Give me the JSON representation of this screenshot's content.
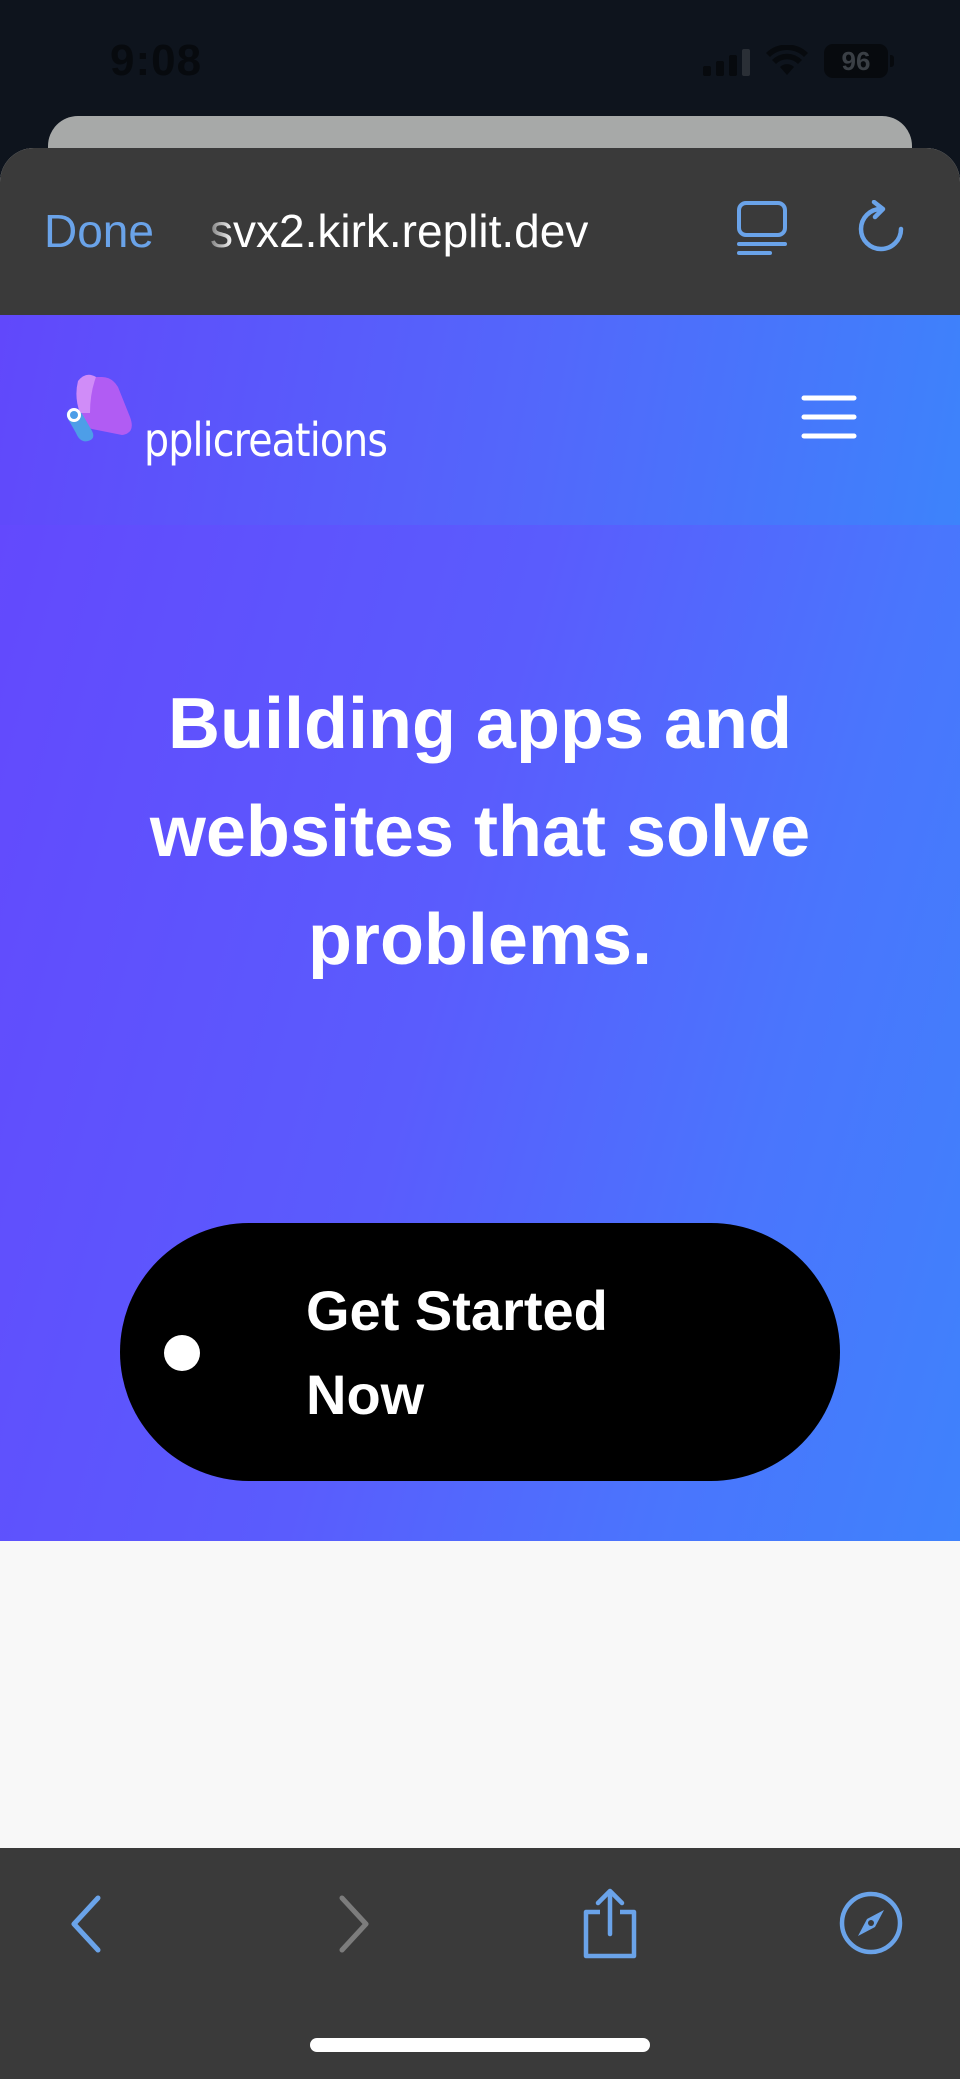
{
  "status_bar": {
    "time": "9:08",
    "battery": "96"
  },
  "browser": {
    "done_label": "Done",
    "url": "svx2.kirk.replit.dev",
    "accent_color": "#6aa3e9",
    "toolbar_icons": [
      "back-icon",
      "forward-icon",
      "share-icon",
      "compass-icon"
    ],
    "top_icons": [
      "reader-icon",
      "reload-icon"
    ]
  },
  "site": {
    "logo_text": "pplicreations",
    "hero_title": "Building apps and websites that solve problems.",
    "cta_label": "Get Started Now",
    "gradient_start": "#6148fb",
    "gradient_end": "#3f82fc",
    "cta_color": "#000000"
  }
}
